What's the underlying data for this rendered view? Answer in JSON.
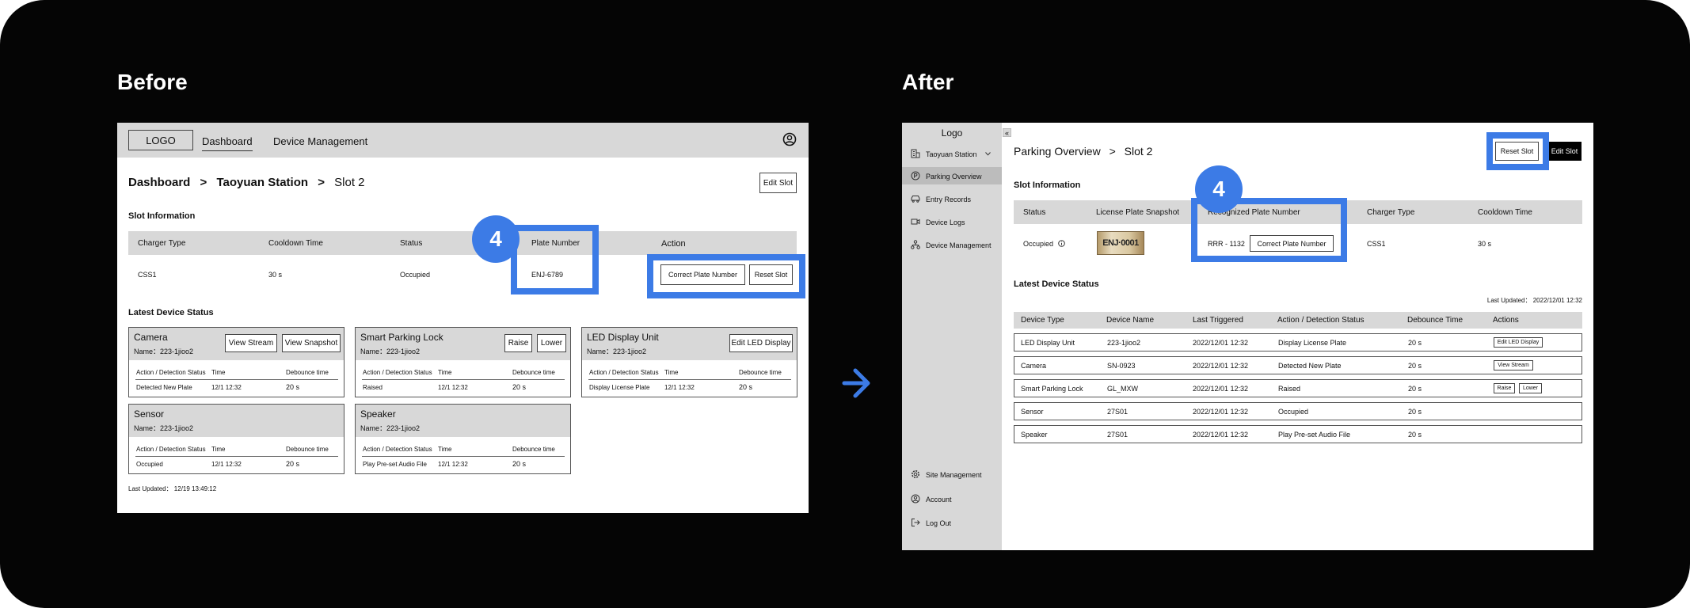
{
  "headings": {
    "before": "Before",
    "after": "After"
  },
  "colors": {
    "accent": "#3c7be6",
    "page_bg": "#050505",
    "header_gray": "#d8d8d8"
  },
  "badge_number": "4",
  "before": {
    "logo": "LOGO",
    "nav": {
      "dashboard": "Dashboard",
      "device_management": "Device Management"
    },
    "breadcrumb": {
      "dashboard": "Dashboard",
      "sep": ">",
      "station": "Taoyuan Station",
      "slot": "Slot 2"
    },
    "edit_slot": "Edit Slot",
    "slot_info_title": "Slot Information",
    "slot_table": {
      "headers": {
        "charger_type": "Charger Type",
        "cooldown": "Cooldown Time",
        "status": "Status",
        "plate": "Plate Number",
        "action": "Action"
      },
      "row": {
        "charger_type": "CSS1",
        "cooldown": "30 s",
        "status": "Occupied",
        "plate": "ENJ-6789"
      }
    },
    "correct_plate": "Correct Plate Number",
    "reset_slot": "Reset Slot",
    "latest_title": "Latest Device Status",
    "cards": [
      {
        "title": "Camera",
        "name": "Name：223-1jioo2",
        "btn1": "View Stream",
        "btn2": "View Snapshot",
        "h_action": "Action / Detection Status",
        "h_time": "Time",
        "h_debounce": "Debounce time",
        "action": "Detected New Plate",
        "time": "12/1 12:32",
        "debounce": "20 s"
      },
      {
        "title": "Smart Parking Lock",
        "name": "Name：223-1jioo2",
        "btn1": "Raise",
        "btn2": "Lower",
        "h_action": "Action / Detection Status",
        "h_time": "Time",
        "h_debounce": "Debounce time",
        "action": "Raised",
        "time": "12/1 12:32",
        "debounce": "20 s"
      },
      {
        "title": "LED Display Unit",
        "name": "Name：223-1jioo2",
        "btn1": "Edit LED Display",
        "h_action": "Action / Detection Status",
        "h_time": "Time",
        "h_debounce": "Debounce time",
        "action": "Display License Plate",
        "time": "12/1 12:32",
        "debounce": "20 s"
      },
      {
        "title": "Sensor",
        "name": "Name：223-1jioo2",
        "h_action": "Action / Detection Status",
        "h_time": "Time",
        "h_debounce": "Debounce time",
        "action": "Occupied",
        "time": "12/1 12:32",
        "debounce": "20 s"
      },
      {
        "title": "Speaker",
        "name": "Name：223-1jioo2",
        "h_action": "Action / Detection Status",
        "h_time": "Time",
        "h_debounce": "Debounce time",
        "action": "Play Pre-set Audio File",
        "time": "12/1 12:32",
        "debounce": "20 s"
      }
    ],
    "last_updated": "Last Updated： 12/19 13:49:12"
  },
  "after": {
    "logo": "Logo",
    "collapse": "«",
    "sidebar": {
      "station": "Taoyuan Station",
      "items": [
        "Parking Overview",
        "Entry Records",
        "Device Logs",
        "Device Management"
      ],
      "bottom": [
        "Site Management",
        "Account",
        "Log Out"
      ]
    },
    "breadcrumb": {
      "overview": "Parking Overview",
      "sep": ">",
      "slot": "Slot 2"
    },
    "reset_slot": "Reset Slot",
    "edit_slot": "Edit Slot",
    "slot_info_title": "Slot Information",
    "slot_table": {
      "headers": {
        "status": "Status",
        "snapshot": "License Plate Snapshot",
        "recognized": "Recognized Plate Number",
        "charger": "Charger Type",
        "cooldown": "Cooldown Time"
      },
      "row": {
        "status": "Occupied",
        "plate_img_text": "ENJ·0001",
        "recognized": "RRR - 1132",
        "charger": "CSS1",
        "cooldown": "30 s"
      }
    },
    "correct_plate": "Correct Plate Number",
    "latest_title": "Latest Device Status",
    "last_updated": "Last Updated： 2022/12/01 12:32",
    "device_table": {
      "headers": [
        "Device Type",
        "Device Name",
        "Last Triggered",
        "Action / Detection Status",
        "Debounce Time",
        "Actions"
      ],
      "rows": [
        {
          "type": "LED Display Unit",
          "name": "223-1jioo2",
          "last": "2022/12/01 12:32",
          "action": "Display License Plate",
          "debounce": "20 s",
          "btn1": "Edit LED Display"
        },
        {
          "type": "Camera",
          "name": "SN-0923",
          "last": "2022/12/01 12:32",
          "action": "Detected New Plate",
          "debounce": "20 s",
          "btn1": "View Stream"
        },
        {
          "type": "Smart Parking Lock",
          "name": "GL_MXW",
          "last": "2022/12/01 12:32",
          "action": "Raised",
          "debounce": "20 s",
          "btn1": "Raise",
          "btn2": "Lower"
        },
        {
          "type": "Sensor",
          "name": "27S01",
          "last": "2022/12/01 12:32",
          "action": "Occupied",
          "debounce": "20 s"
        },
        {
          "type": "Speaker",
          "name": "27S01",
          "last": "2022/12/01 12:32",
          "action": "Play Pre-set Audio File",
          "debounce": "20 s"
        }
      ]
    }
  }
}
